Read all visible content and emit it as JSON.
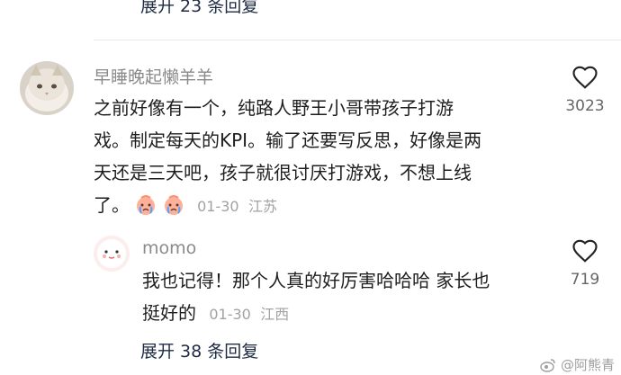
{
  "top_reply_toggle": "展开 23 条回复",
  "comment": {
    "username": "早睡晚起懒羊羊",
    "lines": [
      "之前好像有一个，纯路人野王小哥带孩子打游",
      "戏。制定每天的KPI。输了还要写反思，好像是两",
      "天还是三天吧，孩子就很讨厌打游戏，不想上线",
      "了。"
    ],
    "emojis": [
      "crying-face-emoji",
      "crying-face-emoji"
    ],
    "date": "01-30",
    "location": "江苏",
    "likes": "3023"
  },
  "reply": {
    "username": "momo",
    "lines": [
      "我也记得！那个人真的好厉害哈哈哈 家长也",
      "挺好的"
    ],
    "date": "01-30",
    "location": "江西",
    "likes": "719"
  },
  "bottom_reply_toggle": "展开 38 条回复",
  "watermark": "@阿熊青",
  "colors": {
    "text": "#1e1e1e",
    "username": "#8a8a8a",
    "meta": "#a2a2a2",
    "expand": "#1f2a44"
  }
}
